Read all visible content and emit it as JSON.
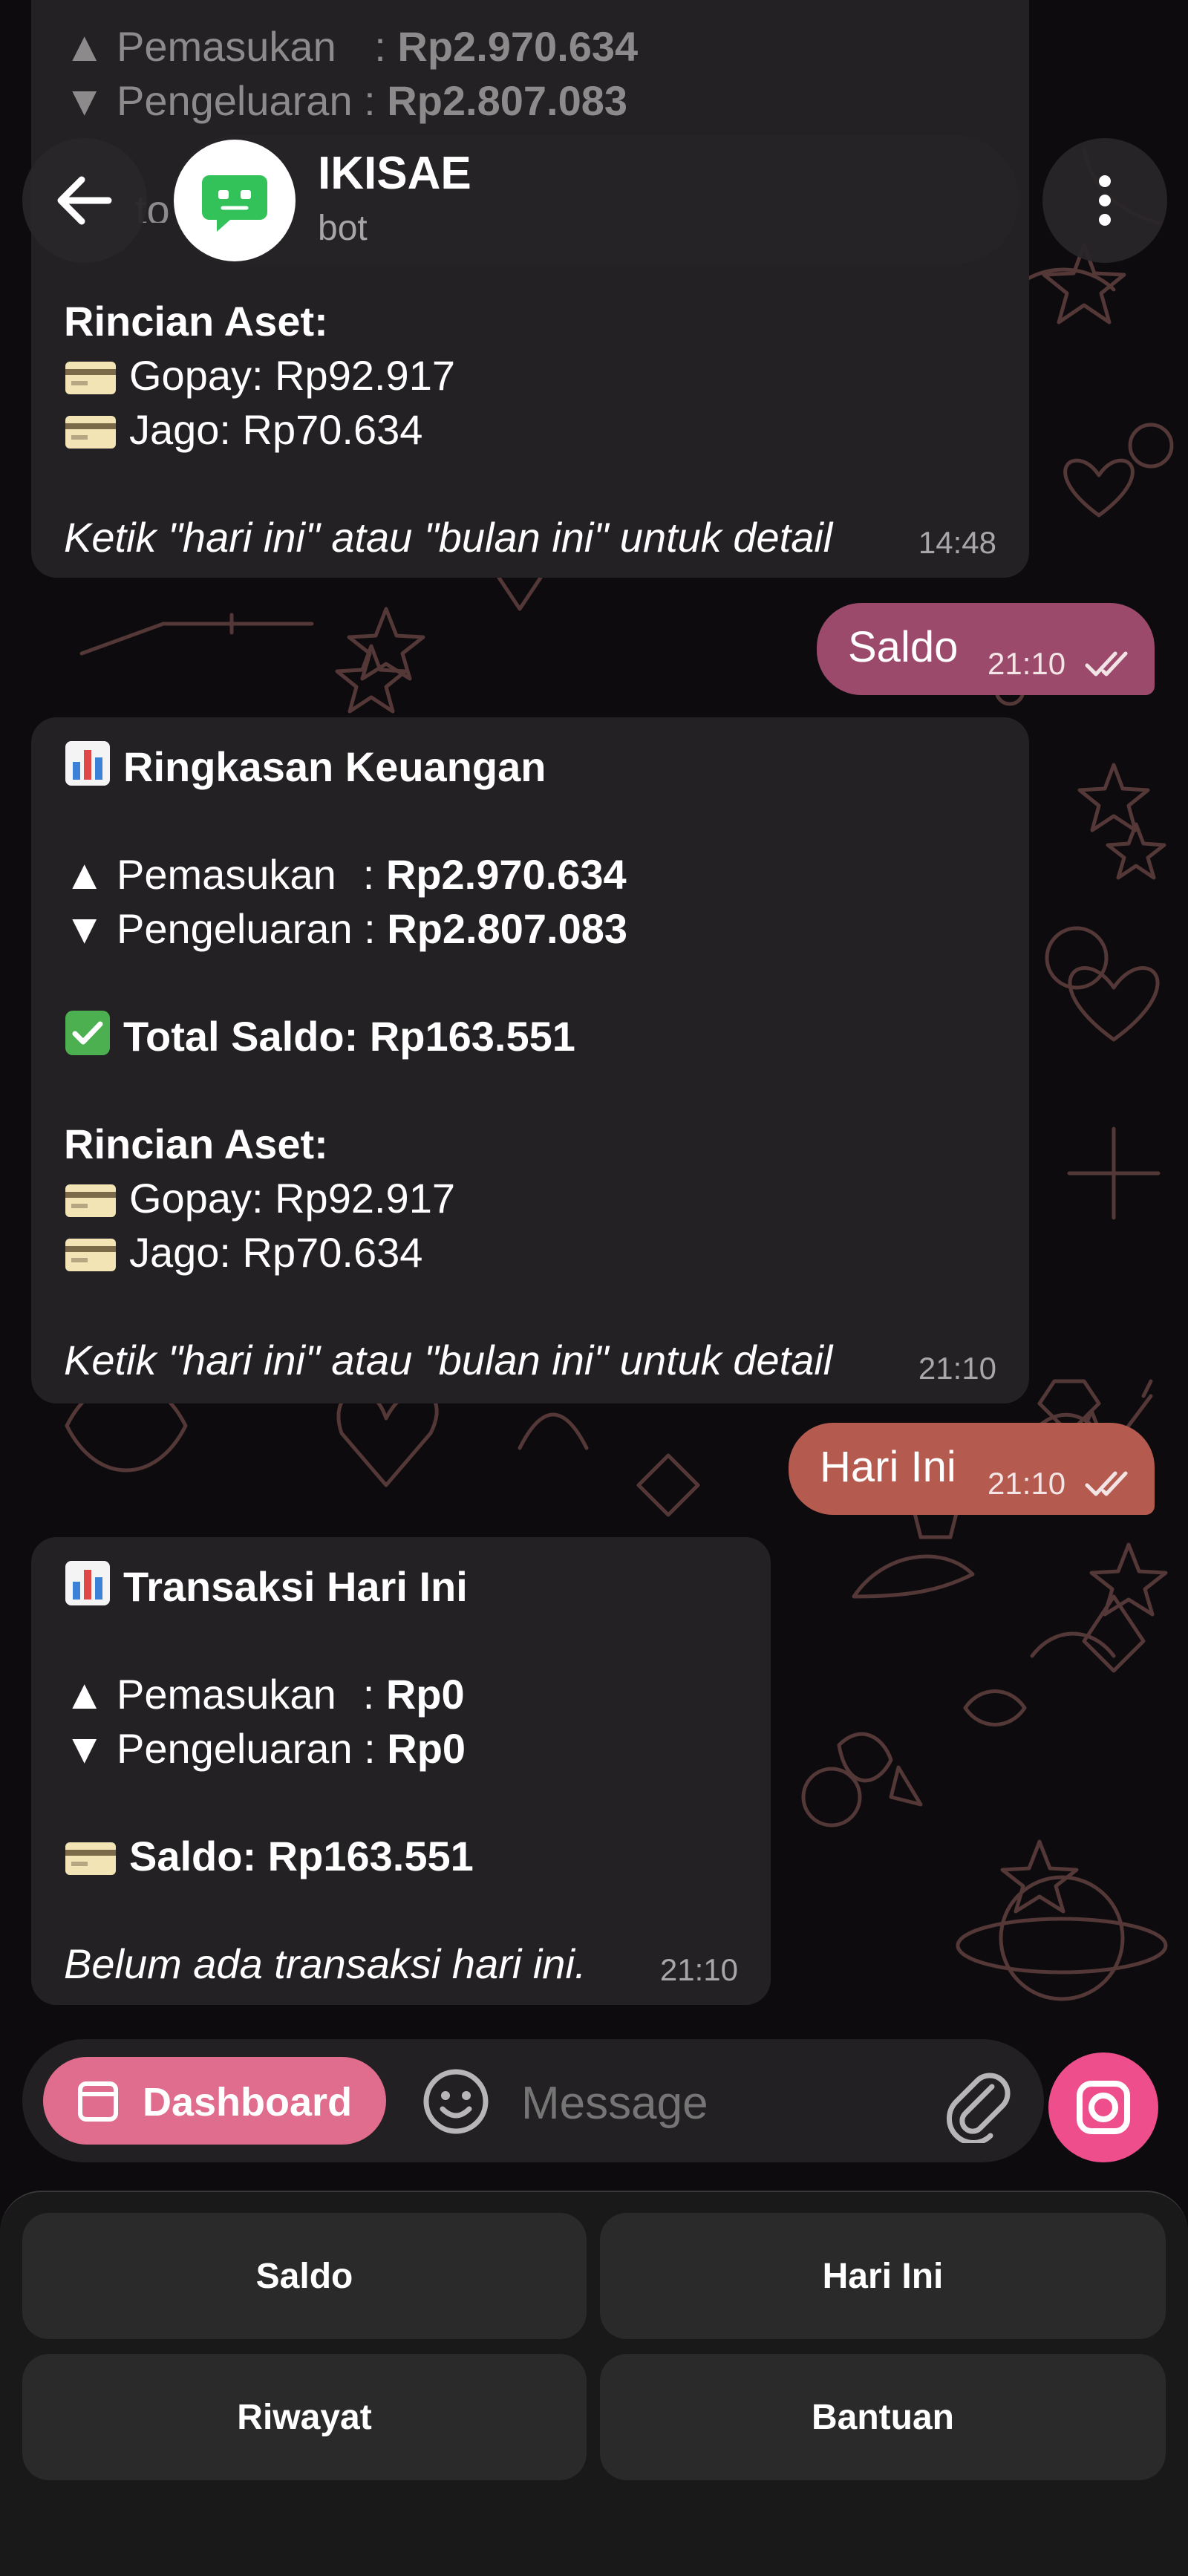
{
  "colors": {
    "background": "#0d0b0d",
    "bubble_in": "#232123",
    "bubble_out_saldo": "#9c4a6c",
    "bubble_out_hariini": "#b45a4e",
    "accent_pink": "#ee4f8c",
    "dashboard_button": "#e06d8d",
    "wallpaper_doodle": "#5c3c3c"
  },
  "header": {
    "name": "IKISAE",
    "status": "bot",
    "avatar_icon": "bot-chat-icon",
    "back_icon": "arrow-left-icon",
    "menu_icon": "kebab-menu-icon"
  },
  "top_partial": {
    "pemasukan_label": "▲ Pemasukan",
    "pemasukan_colon": ":",
    "pemasukan_value": "Rp2.970.634",
    "pengeluaran_label": "▼ Pengeluaran :",
    "pengeluaran_value": "Rp2.807.083",
    "peek_text": "to"
  },
  "messages": {
    "first_summary": {
      "aset_title": "Rincian Aset:",
      "gopay": "Gopay: Rp92.917",
      "jago": "Jago: Rp70.634",
      "hint": "Ketik \"hari ini\" atau \"bulan ini\" untuk detail",
      "time": "14:48"
    },
    "saldo_out": {
      "text": "Saldo",
      "time": "21:10"
    },
    "ringkasan": {
      "title": "Ringkasan Keuangan",
      "pemasukan_label": "▲ Pemasukan",
      "pemasukan_colon": ":",
      "pemasukan_value": "Rp2.970.634",
      "pengeluaran_label": "▼ Pengeluaran :",
      "pengeluaran_value": "Rp2.807.083",
      "total": "Total Saldo: Rp163.551",
      "aset_title": "Rincian Aset:",
      "gopay": "Gopay: Rp92.917",
      "jago": "Jago: Rp70.634",
      "hint": "Ketik \"hari ini\" atau \"bulan ini\" untuk detail",
      "time": "21:10"
    },
    "hariini_out": {
      "text": "Hari Ini",
      "time": "21:10"
    },
    "transaksi": {
      "title": "Transaksi Hari Ini",
      "pemasukan_label": "▲ Pemasukan",
      "pemasukan_colon": ":",
      "pemasukan_value": "Rp0",
      "pengeluaran_label": "▼ Pengeluaran :",
      "pengeluaran_value": "Rp0",
      "saldo": "Saldo: Rp163.551",
      "note": "Belum ada transaksi hari ini.",
      "time": "21:10"
    }
  },
  "input_bar": {
    "dashboard_label": "Dashboard",
    "placeholder": "Message",
    "emoji_icon": "smiley-icon",
    "attach_icon": "paperclip-icon",
    "camera_icon": "camera-icon"
  },
  "keyboard": {
    "buttons": [
      "Saldo",
      "Hari Ini",
      "Riwayat",
      "Bantuan"
    ]
  }
}
